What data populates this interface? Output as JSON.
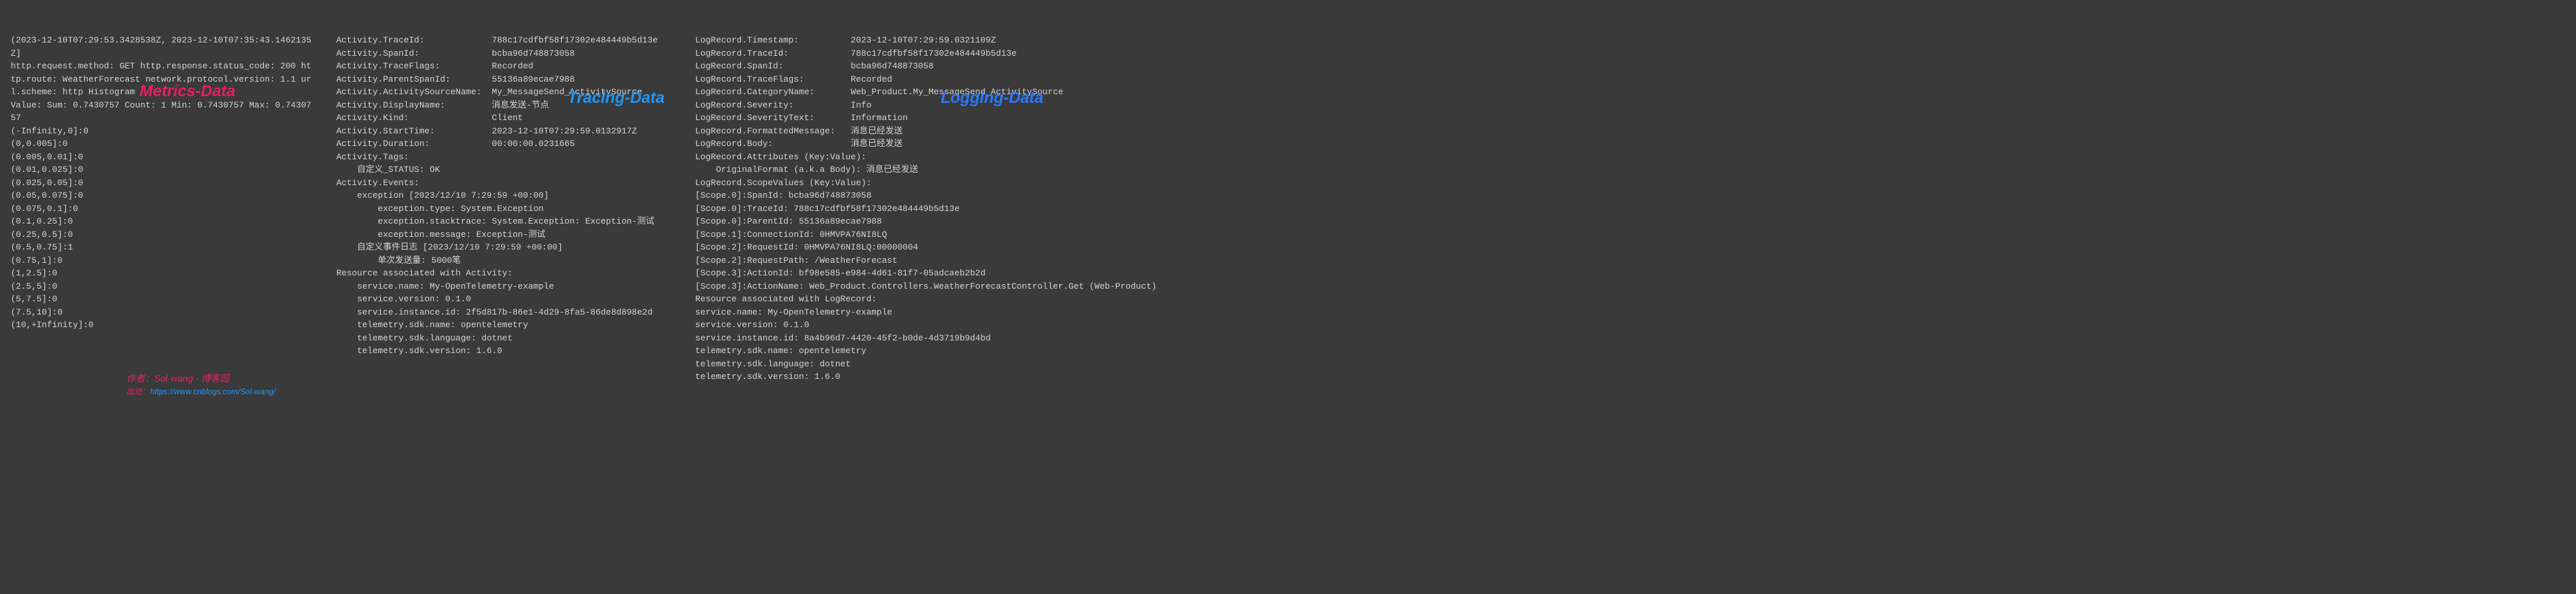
{
  "labels": {
    "metrics": "Metrics-Data",
    "tracing": "Tracing-Data",
    "logging": "Logging-Data"
  },
  "author": {
    "line1_prefix": "作者：",
    "line1_name": "Sol·wang - 博客园",
    "line2_prefix": "出处：",
    "line2_url": "https://www.cnblogs.com/Sol-wang/"
  },
  "metrics": {
    "lines": [
      "(2023-12-10T07:29:53.3428538Z, 2023-12-10T07:35:43.1462135Z]",
      "http.request.method: GET http.response.status_code: 200 http.route: WeatherForecast network.protocol.version: 1.1 url.scheme: http Histogram",
      "Value: Sum: 0.7430757 Count: 1 Min: 0.7430757 Max: 0.7430757",
      "(-Infinity,0]:0",
      "(0,0.005]:0",
      "(0.005,0.01]:0",
      "(0.01,0.025]:0",
      "(0.025,0.05]:0",
      "(0.05,0.075]:0",
      "(0.075,0.1]:0",
      "(0.1,0.25]:0",
      "(0.25,0.5]:0",
      "(0.5,0.75]:1",
      "(0.75,1]:0",
      "(1,2.5]:0",
      "(2.5,5]:0",
      "(5,7.5]:0",
      "(7.5,10]:0",
      "(10,+Infinity]:0"
    ]
  },
  "tracing": {
    "kv": [
      [
        "Activity.TraceId:",
        "788c17cdfbf58f17302e484449b5d13e"
      ],
      [
        "Activity.SpanId:",
        "bcba96d748873058"
      ],
      [
        "Activity.TraceFlags:",
        "Recorded"
      ],
      [
        "Activity.ParentSpanId:",
        "55136a89ecae7988"
      ],
      [
        "Activity.ActivitySourceName:",
        "My_MessageSend_ActivitySource"
      ],
      [
        "Activity.DisplayName:",
        "消息发送-节点"
      ],
      [
        "Activity.Kind:",
        "Client"
      ],
      [
        "Activity.StartTime:",
        "2023-12-10T07:29:59.0132917Z"
      ],
      [
        "Activity.Duration:",
        "00:00:00.0231665"
      ]
    ],
    "tags_header": "Activity.Tags:",
    "tags_line": "    自定义_STATUS: OK",
    "events_header": "Activity.Events:",
    "events": [
      "    exception [2023/12/10 7:29:59 +00:00]",
      "        exception.type: System.Exception",
      "        exception.stacktrace: System.Exception: Exception-测试",
      "        exception.message: Exception-测试",
      "    自定义事件日志 [2023/12/10 7:29:59 +00:00]",
      "        单次发送量: 5000笔"
    ],
    "resource_header": "Resource associated with Activity:",
    "resource": [
      "    service.name: My-OpenTelemetry-example",
      "    service.version: 0.1.0",
      "    service.instance.id: 2f5d817b-86e1-4d29-8fa5-86de8d898e2d",
      "    telemetry.sdk.name: opentelemetry",
      "    telemetry.sdk.language: dotnet",
      "    telemetry.sdk.version: 1.6.0"
    ]
  },
  "logging": {
    "kv": [
      [
        "LogRecord.Timestamp:",
        "2023-12-10T07:29:59.0321109Z"
      ],
      [
        "LogRecord.TraceId:",
        "788c17cdfbf58f17302e484449b5d13e"
      ],
      [
        "LogRecord.SpanId:",
        "bcba96d748873058"
      ],
      [
        "LogRecord.TraceFlags:",
        "Recorded"
      ],
      [
        "LogRecord.CategoryName:",
        "Web_Product.My_MessageSend_ActivitySource"
      ],
      [
        "LogRecord.Severity:",
        "Info"
      ],
      [
        "LogRecord.SeverityText:",
        "Information"
      ],
      [
        "LogRecord.FormattedMessage:",
        "消息已经发送"
      ],
      [
        "LogRecord.Body:",
        "消息已经发送"
      ]
    ],
    "attrs_header": "LogRecord.Attributes (Key:Value):",
    "attrs_line": "    OriginalFormat (a.k.a Body): 消息已经发送",
    "scope_header": "LogRecord.ScopeValues (Key:Value):",
    "scopes": [
      "[Scope.0]:SpanId: bcba96d748873058",
      "[Scope.0]:TraceId: 788c17cdfbf58f17302e484449b5d13e",
      "[Scope.0]:ParentId: 55136a89ecae7988",
      "[Scope.1]:ConnectionId: 0HMVPA76NI8LQ",
      "[Scope.2]:RequestId: 0HMVPA76NI8LQ:00000004",
      "[Scope.2]:RequestPath: /WeatherForecast",
      "[Scope.3]:ActionId: bf98e585-e984-4d61-81f7-05adcaeb2b2d",
      "[Scope.3]:ActionName: Web_Product.Controllers.WeatherForecastController.Get (Web-Product)"
    ],
    "resource_header": "Resource associated with LogRecord:",
    "resource": [
      "service.name: My-OpenTelemetry-example",
      "service.version: 0.1.0",
      "service.instance.id: 8a4b96d7-4420-45f2-b0de-4d3719b9d4bd",
      "telemetry.sdk.name: opentelemetry",
      "telemetry.sdk.language: dotnet",
      "telemetry.sdk.version: 1.6.0"
    ]
  }
}
